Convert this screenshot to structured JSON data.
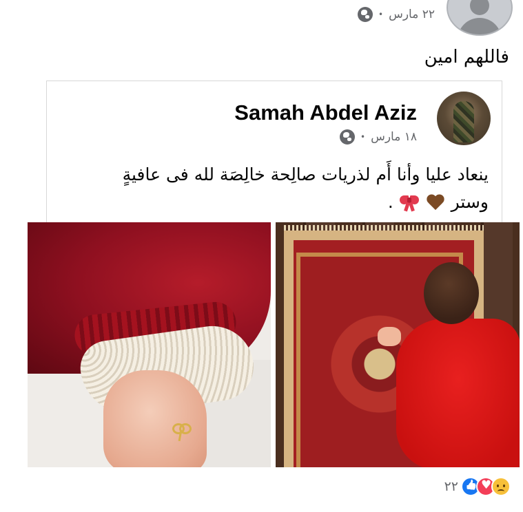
{
  "parent_post": {
    "time": "٢٢ مارس",
    "separator": "•",
    "privacy_icon": "globe-icon",
    "text": "فاللهم امين"
  },
  "shared_post": {
    "author": "Samah Abdel Aziz",
    "time": "١٨ مارس",
    "separator": "•",
    "privacy_icon": "globe-icon",
    "text_line1": "ينعاد عليا وأنا أَم لذريات صالِحة خالِصَة لله فى عافيةٍ",
    "text_line2_prefix": "وستر",
    "text_line2_suffix": ".",
    "emojis": [
      "brown-heart-icon",
      "ribbon-bow-icon"
    ]
  },
  "photos": [
    {
      "name": "baby-hand-photo",
      "subject": "baby hand with bow ring"
    },
    {
      "name": "baby-prayer-rug-photo",
      "subject": "baby on prayer rug"
    }
  ],
  "reactions": {
    "icons": [
      "sad-reaction-icon",
      "love-reaction-icon",
      "like-reaction-icon"
    ],
    "count": "٢٢"
  },
  "colors": {
    "meta_gray": "#65676b",
    "like_blue": "#1877f2",
    "love_red": "#f33e58"
  }
}
